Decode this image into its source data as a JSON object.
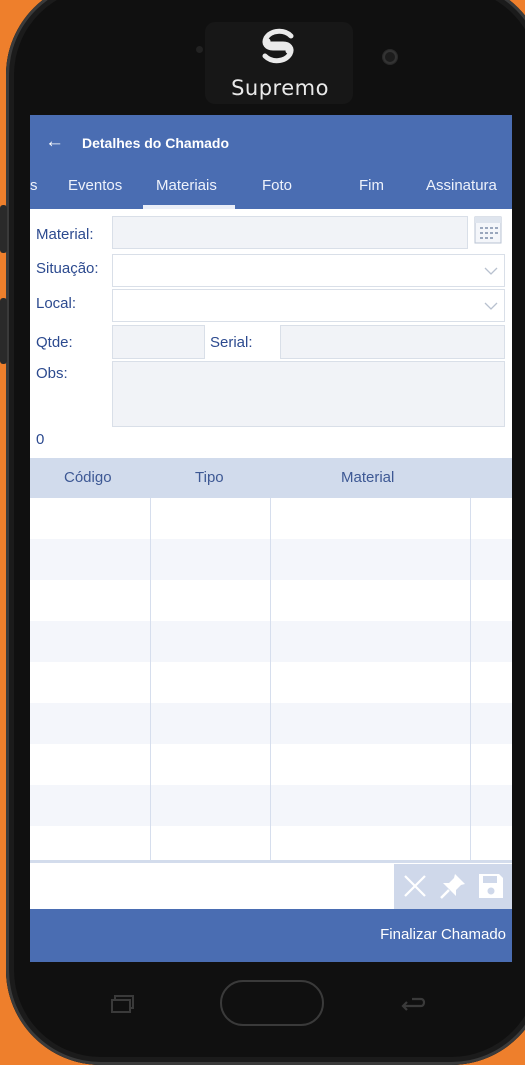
{
  "device": {
    "brand": "Supremo"
  },
  "app_bar": {
    "back_icon": "←",
    "title": "Detalhes do Chamado"
  },
  "tabs": [
    {
      "label": "s"
    },
    {
      "label": "Eventos"
    },
    {
      "label": "Materiais"
    },
    {
      "label": "Foto"
    },
    {
      "label": "Fim"
    },
    {
      "label": "Assinatura"
    }
  ],
  "selected_tab": "Materiais",
  "form": {
    "material_label": "Material:",
    "situacao_label": "Situação:",
    "local_label": "Local:",
    "qtde_label": "Qtde:",
    "serial_label": "Serial:",
    "obs_label": "Obs:",
    "count": "0"
  },
  "table": {
    "columns": [
      {
        "label": "Código"
      },
      {
        "label": "Tipo"
      },
      {
        "label": "Material"
      }
    ]
  },
  "toolbar": {
    "icons": [
      "close-icon",
      "pin-icon",
      "save-icon"
    ]
  },
  "footer": {
    "finalizar_label": "Finalizar Chamado"
  },
  "colors": {
    "primary": "#4a6db2",
    "header_row": "#d1dbec",
    "label_text": "#2c4a8f",
    "frame_bg": "#ee7f2c"
  }
}
